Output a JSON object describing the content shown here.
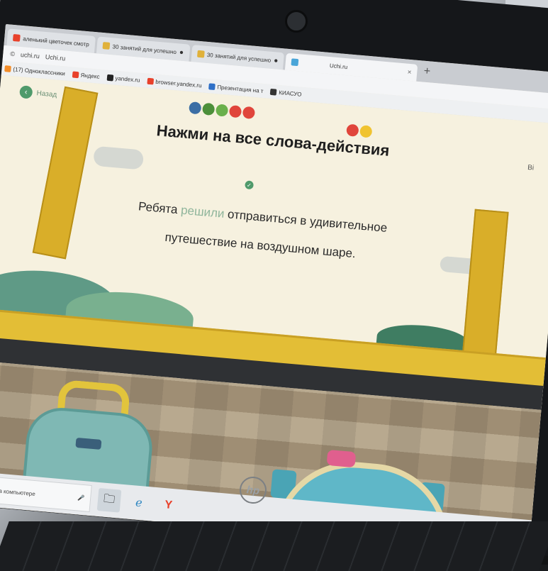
{
  "browser": {
    "tabs": [
      {
        "label": "аленький цветочек смотр",
        "fav_color": "#e8412b"
      },
      {
        "label": "30 занятий для успешно",
        "fav_color": "#e0b13a"
      },
      {
        "label": "30 занятий для успешно",
        "fav_color": "#e0b13a"
      },
      {
        "label": "Uchi.ru",
        "fav_color": "#4aa5d8",
        "active": true
      }
    ],
    "new_tab": "+",
    "close": "×",
    "address": {
      "url": "uchi.ru",
      "title": "Uchi.ru"
    },
    "bookmarks": [
      {
        "label": "(17) Одноклассники",
        "icon_color": "#f28c28"
      },
      {
        "label": "Яндекс",
        "icon_color": "#e8412b"
      },
      {
        "label": "yandex.ru",
        "icon_color": "#222222"
      },
      {
        "label": "browser.yandex.ru",
        "icon_color": "#e8412b"
      },
      {
        "label": "Презентация на т",
        "icon_color": "#2e6fc7"
      },
      {
        "label": "КИАСУО",
        "icon_color": "#333333"
      }
    ]
  },
  "page": {
    "back_label": "Назад",
    "right_link": "Ві",
    "title": "Нажми на все слова-действия",
    "sentence_words": [
      {
        "text": "Ребята",
        "selected": false
      },
      {
        "text": "решили",
        "selected": true
      },
      {
        "text": "отправиться",
        "selected": false
      },
      {
        "text": "в",
        "selected": false
      },
      {
        "text": "удивительное",
        "selected": false
      },
      {
        "text": "путешествие",
        "selected": false
      },
      {
        "text": "на",
        "selected": false
      },
      {
        "text": "воздушном",
        "selected": false
      },
      {
        "text": "шаре.",
        "selected": false
      }
    ],
    "fruits_left": [
      "#3b6ea5",
      "#4c8f3a",
      "#6ab04c",
      "#e0453b",
      "#e0453b"
    ],
    "fruits_right": [
      "#e0453b",
      "#f0c330"
    ]
  },
  "taskbar": {
    "search_text": "ндексе и на компьютере",
    "mic_icon": "microphone-icon",
    "icons": [
      "explorer-icon",
      "ie-icon",
      "yandex-icon"
    ]
  },
  "device": {
    "logo": "hp"
  },
  "colors": {
    "accent": "#4f9a6b",
    "title": "#1f1f1f",
    "selected_word": "#8fb59b"
  }
}
